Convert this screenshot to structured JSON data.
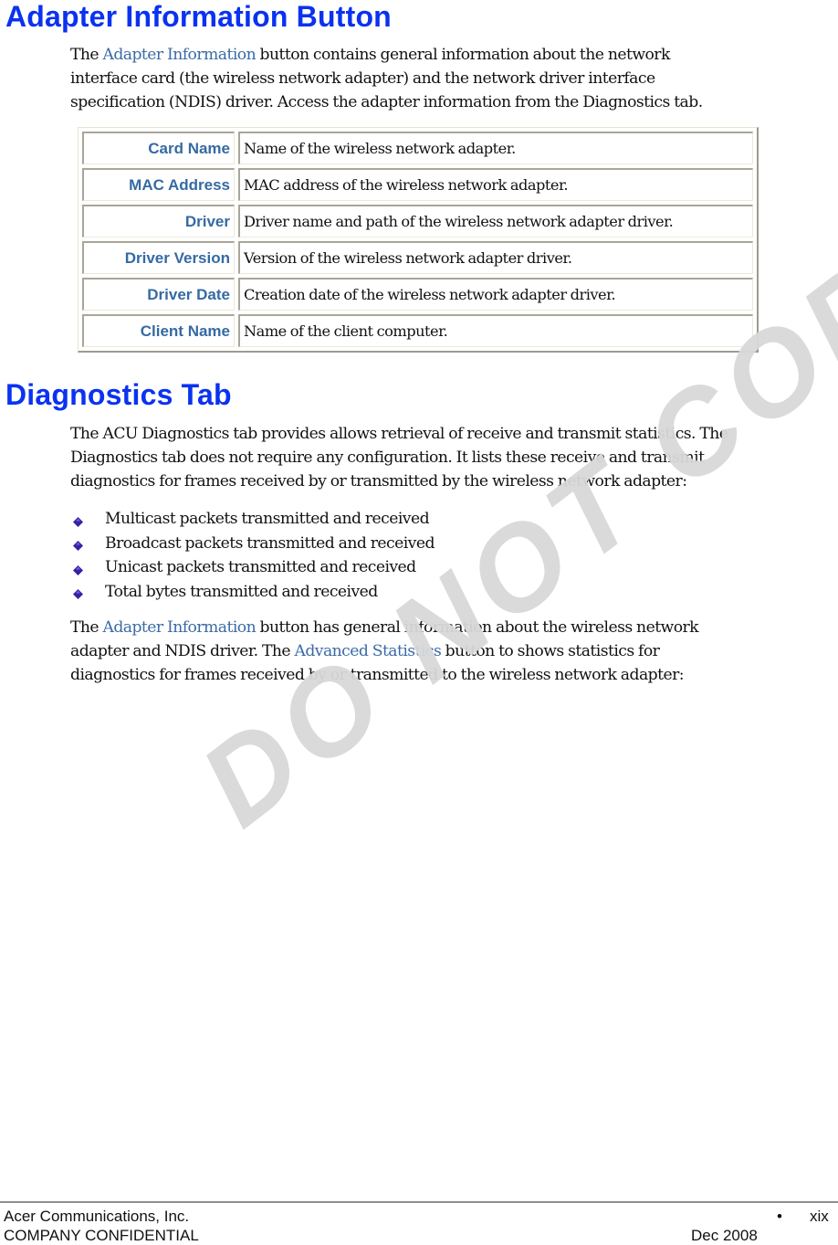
{
  "sections": {
    "adapter_info": {
      "title": "Adapter Information Button",
      "intro": {
        "prefix": "The ",
        "link": "Adapter Information",
        "line1_rest": " button contains general information about the network",
        "line2": "interface card (the wireless network adapter) and the network driver interface",
        "line3": "specification (NDIS) driver.  Access the adapter information from the Diagnostics tab."
      },
      "table": [
        {
          "term": "Card Name",
          "description": "Name of the wireless network adapter."
        },
        {
          "term": "MAC Address",
          "description": "MAC address of the wireless network adapter."
        },
        {
          "term": "Driver",
          "description": "Driver name and path of the wireless network adapter driver."
        },
        {
          "term": "Driver Version",
          "description": "Version of the wireless network adapter driver."
        },
        {
          "term": "Driver Date",
          "description": "Creation date of the wireless network adapter driver."
        },
        {
          "term": "Client Name",
          "description": "Name of the client computer."
        }
      ]
    },
    "diagnostics_tab": {
      "title": "Diagnostics Tab",
      "intro": {
        "line1": "The ACU Diagnostics tab provides allows retrieval of receive and transmit statistics. The",
        "line2": "Diagnostics tab does not require any configuration.  It lists these receive and transmit",
        "line3": "diagnostics for frames received by or transmitted by the wireless network adapter:"
      },
      "bullets": [
        "Multicast packets transmitted and received",
        "Broadcast packets transmitted and received",
        "Unicast packets transmitted and received",
        "Total bytes transmitted and received"
      ],
      "bullet_icon": "purple-diamond-bullet-icon",
      "closing": {
        "prefix": "The ",
        "link1": "Adapter Information",
        "line1_rest": " button has general information about the wireless network",
        "line2_prefix": "adapter and NDIS driver.  The ",
        "link2": "Advanced Statistics",
        "line2_rest": " button to shows statistics for",
        "line3": "diagnostics for frames received by or transmitted to the wireless network adapter:"
      }
    }
  },
  "footer": {
    "company": "Acer Communications, Inc.",
    "confidential": "COMPANY CONFIDENTIAL",
    "bullet": "•",
    "page_number": "xix",
    "date": "Dec 2008"
  },
  "watermark": "DO NOT COPY",
  "colors": {
    "heading": "#0a32f0",
    "link": "#3a6aa6",
    "term": "#356aa3",
    "bullet": "#3b1fa8",
    "watermark": "#d9d9d9"
  }
}
